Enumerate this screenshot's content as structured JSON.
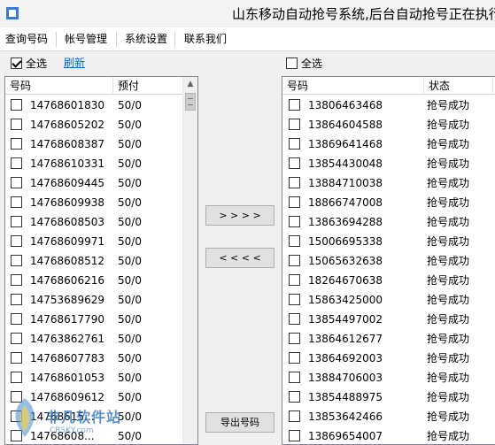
{
  "window": {
    "title": "山东移动自动抢号系统,后台自动抢号正在执行"
  },
  "menu": [
    {
      "label": "查询号码",
      "name": "menu-query-numbers"
    },
    {
      "label": "帐号管理",
      "name": "menu-account-management"
    },
    {
      "label": "系统设置",
      "name": "menu-system-settings"
    },
    {
      "label": "联系我们",
      "name": "menu-contact-us"
    }
  ],
  "left_panel": {
    "select_all_label": "全选",
    "select_all_checked": true,
    "refresh_label": "刷新",
    "columns": [
      "号码",
      "预付"
    ],
    "rows": [
      {
        "number": "14768601830",
        "prepay": "50/0"
      },
      {
        "number": "14768605202",
        "prepay": "50/0"
      },
      {
        "number": "14768608387",
        "prepay": "50/0"
      },
      {
        "number": "14768610331",
        "prepay": "50/0"
      },
      {
        "number": "14768609445",
        "prepay": "50/0"
      },
      {
        "number": "14768609938",
        "prepay": "50/0"
      },
      {
        "number": "14768608503",
        "prepay": "50/0"
      },
      {
        "number": "14768609971",
        "prepay": "50/0"
      },
      {
        "number": "14768608512",
        "prepay": "50/0"
      },
      {
        "number": "14768606216",
        "prepay": "50/0"
      },
      {
        "number": "14753689629",
        "prepay": "50/0"
      },
      {
        "number": "14768617790",
        "prepay": "50/0"
      },
      {
        "number": "14763862761",
        "prepay": "50/0"
      },
      {
        "number": "14768607783",
        "prepay": "50/0"
      },
      {
        "number": "14768601053",
        "prepay": "50/0"
      },
      {
        "number": "14768609612",
        "prepay": "50/0"
      },
      {
        "number": "14768615...",
        "prepay": "50/0"
      },
      {
        "number": "14768608...",
        "prepay": "50/0"
      }
    ]
  },
  "right_panel": {
    "select_all_label": "全选",
    "select_all_checked": false,
    "columns": [
      "号码",
      "状态"
    ],
    "rows": [
      {
        "number": "13806463468",
        "status": "抢号成功"
      },
      {
        "number": "13864604588",
        "status": "抢号成功"
      },
      {
        "number": "13869641468",
        "status": "抢号成功"
      },
      {
        "number": "13854430048",
        "status": "抢号成功"
      },
      {
        "number": "13884710038",
        "status": "抢号成功"
      },
      {
        "number": "18866747008",
        "status": "抢号成功"
      },
      {
        "number": "13863694288",
        "status": "抢号成功"
      },
      {
        "number": "15006695338",
        "status": "抢号成功"
      },
      {
        "number": "15065632638",
        "status": "抢号成功"
      },
      {
        "number": "18264670638",
        "status": "抢号成功"
      },
      {
        "number": "15863425000",
        "status": "抢号成功"
      },
      {
        "number": "13854497002",
        "status": "抢号成功"
      },
      {
        "number": "13864612677",
        "status": "抢号成功"
      },
      {
        "number": "13864692003",
        "status": "抢号成功"
      },
      {
        "number": "13884706003",
        "status": "抢号成功"
      },
      {
        "number": "13854488975",
        "status": "抢号成功"
      },
      {
        "number": "13853642466",
        "status": "抢号成功"
      },
      {
        "number": "13869654007",
        "status": "抢号成功"
      }
    ]
  },
  "buttons": {
    "move_right": "> > > >",
    "move_left": "< < < <",
    "export": "导出号码"
  },
  "watermark": {
    "text": "非凡软件站",
    "sub": "CRSKY.com"
  },
  "colors": {
    "link": "#0066cc",
    "grid_border": "#828790",
    "button_bg": "#e1e1e1"
  }
}
